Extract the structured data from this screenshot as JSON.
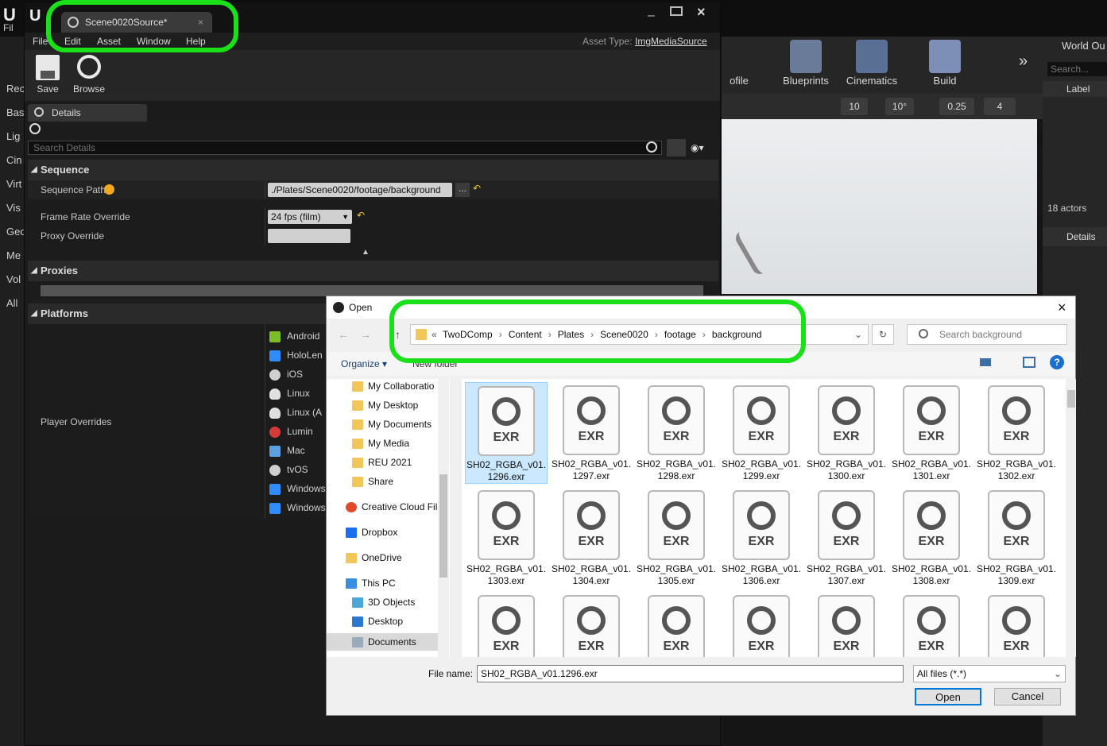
{
  "bg": {
    "left_labels": [
      "Rec",
      "Bas",
      "Lig",
      "Cin",
      "Virt",
      "Vis",
      "Geo",
      "Me",
      "Vol",
      "All"
    ],
    "toolbar": [
      {
        "label": "ofile"
      },
      {
        "label": "Blueprints"
      },
      {
        "label": "Cinematics"
      },
      {
        "label": "Build"
      }
    ],
    "viewport_bar": {
      "grid": "10",
      "rot": "10°",
      "scale": "0.25",
      "cam": "4"
    },
    "world_outliner": {
      "title": "World Ou",
      "search": "Search...",
      "label_col": "Label",
      "actors": "18 actors",
      "details": "Details"
    }
  },
  "asset_editor": {
    "tab_title": "Scene0020Source*",
    "menu": [
      "File",
      "Edit",
      "Asset",
      "Window",
      "Help"
    ],
    "asset_type_label": "Asset Type:",
    "asset_type_value": "ImgMediaSource",
    "tools": [
      {
        "label": "Save",
        "icon": "save-icon"
      },
      {
        "label": "Browse",
        "icon": "browse-icon"
      }
    ],
    "details_tab": "Details",
    "search_placeholder": "Search Details",
    "sections": {
      "sequence": "Sequence",
      "proxies": "Proxies",
      "platforms": "Platforms"
    },
    "sequence_path_label": "Sequence Path",
    "sequence_path_value": "./Plates/Scene0020/footage/background",
    "browse_dots": "...",
    "frame_rate_label": "Frame Rate Override",
    "frame_rate_value": "24 fps (film)",
    "proxy_override_label": "Proxy Override",
    "player_overrides_label": "Player Overrides",
    "platforms": [
      "Android",
      "HoloLen",
      "iOS",
      "Linux",
      "Linux (A",
      "Lumin",
      "Mac",
      "tvOS",
      "Windows",
      "Windows"
    ]
  },
  "dialog": {
    "title": "Open",
    "breadcrumb": [
      "TwoDComp",
      "Content",
      "Plates",
      "Scene0020",
      "footage",
      "background"
    ],
    "search_placeholder": "Search background",
    "organize": "Organize ▾",
    "new_folder": "New folder",
    "nav_items": [
      "My Collaboratio",
      "My Desktop",
      "My Documents",
      "My Media",
      "REU 2021",
      "Share",
      "Creative Cloud Fil",
      "Dropbox",
      "OneDrive",
      "This PC",
      "3D Objects",
      "Desktop",
      "Documents"
    ],
    "file_ext_badge": "EXR",
    "files": [
      "SH02_RGBA_v01.\n1296.exr",
      "SH02_RGBA_v01.\n1297.exr",
      "SH02_RGBA_v01.\n1298.exr",
      "SH02_RGBA_v01.\n1299.exr",
      "SH02_RGBA_v01.\n1300.exr",
      "SH02_RGBA_v01.\n1301.exr",
      "SH02_RGBA_v01.\n1302.exr",
      "SH02_RGBA_v01.\n1303.exr",
      "SH02_RGBA_v01.\n1304.exr",
      "SH02_RGBA_v01.\n1305.exr",
      "SH02_RGBA_v01.\n1306.exr",
      "SH02_RGBA_v01.\n1307.exr",
      "SH02_RGBA_v01.\n1308.exr",
      "SH02_RGBA_v01.\n1309.exr",
      "",
      "",
      "",
      "",
      "",
      "",
      ""
    ],
    "file_name_label": "File name:",
    "file_name_value": "SH02_RGBA_v01.1296.exr",
    "file_type": "All files (*.*)",
    "open_button": "Open",
    "cancel_button": "Cancel"
  },
  "colors": {
    "highlight": "#19e019",
    "accent": "#ff9a1a"
  }
}
